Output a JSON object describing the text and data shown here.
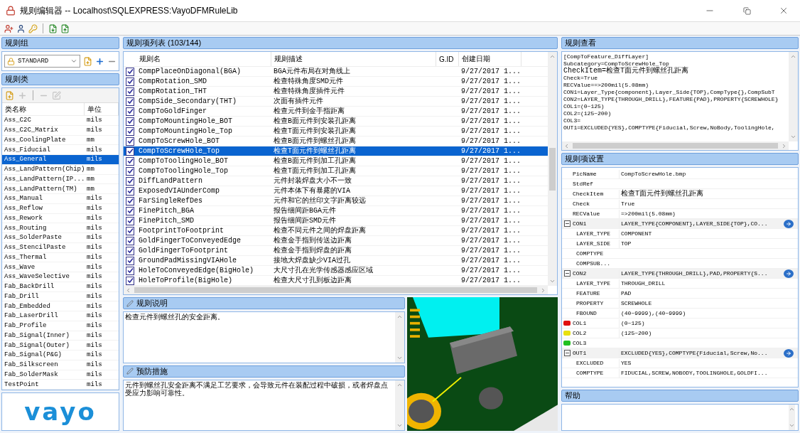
{
  "window": {
    "title": "规则编辑器 -- Localhost\\SQLEXPRESS:VayoDFMRuleLib"
  },
  "toolbar": [
    {
      "kind": "add_user"
    },
    {
      "kind": "user"
    },
    {
      "kind": "key"
    },
    {
      "kind": "separator"
    },
    {
      "kind": "import"
    },
    {
      "kind": "export"
    }
  ],
  "rule_group": {
    "title": "规则组",
    "value": "STANDARD",
    "tools": [
      {
        "kind": "new"
      },
      {
        "kind": "add"
      },
      {
        "kind": "remove"
      }
    ]
  },
  "rule_class": {
    "title": "规则类",
    "tools": [
      {
        "kind": "new",
        "disabled": false
      },
      {
        "kind": "add",
        "disabled": true
      },
      {
        "kind": "separator"
      },
      {
        "kind": "remove",
        "disabled": true
      },
      {
        "kind": "edit",
        "disabled": true
      }
    ],
    "columns": [
      "类名称",
      "单位"
    ],
    "rows": [
      {
        "name": "Ass_C2C",
        "unit": "mils",
        "selected": false
      },
      {
        "name": "Ass_C2C_Matrix",
        "unit": "mils",
        "selected": false
      },
      {
        "name": "Ass_CoolingPlate",
        "unit": "mm",
        "selected": false
      },
      {
        "name": "Ass_Fiducial",
        "unit": "mils",
        "selected": false
      },
      {
        "name": "Ass_General",
        "unit": "mils",
        "selected": true
      },
      {
        "name": "Ass_LandPattern(Chip)",
        "unit": "mm",
        "selected": false
      },
      {
        "name": "Ass_LandPattern(IP...",
        "unit": "mm",
        "selected": false
      },
      {
        "name": "Ass_LandPattern(TM)",
        "unit": "mm",
        "selected": false
      },
      {
        "name": "Ass_Manual",
        "unit": "mils",
        "selected": false
      },
      {
        "name": "Ass_Reflow",
        "unit": "mils",
        "selected": false
      },
      {
        "name": "Ass_Rework",
        "unit": "mils",
        "selected": false
      },
      {
        "name": "Ass_Routing",
        "unit": "mils",
        "selected": false
      },
      {
        "name": "Ass_SolderPaste",
        "unit": "mils",
        "selected": false
      },
      {
        "name": "Ass_StencilPaste",
        "unit": "mils",
        "selected": false
      },
      {
        "name": "Ass_Thermal",
        "unit": "mils",
        "selected": false
      },
      {
        "name": "Ass_Wave",
        "unit": "mils",
        "selected": false
      },
      {
        "name": "Ass_WaveSelective",
        "unit": "mils",
        "selected": false
      },
      {
        "name": "Fab_BackDrill",
        "unit": "mils",
        "selected": false
      },
      {
        "name": "Fab_Drill",
        "unit": "mils",
        "selected": false
      },
      {
        "name": "Fab_Embedded",
        "unit": "mils",
        "selected": false
      },
      {
        "name": "Fab_LaserDrill",
        "unit": "mils",
        "selected": false
      },
      {
        "name": "Fab_Profile",
        "unit": "mils",
        "selected": false
      },
      {
        "name": "Fab_Signal(Inner)",
        "unit": "mils",
        "selected": false
      },
      {
        "name": "Fab_Signal(Outer)",
        "unit": "mils",
        "selected": false
      },
      {
        "name": "Fab_Signal(P&G)",
        "unit": "mils",
        "selected": false
      },
      {
        "name": "Fab_Silkscreen",
        "unit": "mils",
        "selected": false
      },
      {
        "name": "Fab_SolderMask",
        "unit": "mils",
        "selected": false
      },
      {
        "name": "TestPoint",
        "unit": "mils",
        "selected": false
      }
    ]
  },
  "logo": "vayo",
  "rule_list": {
    "title": "规则项列表 (103/144)",
    "columns": [
      "规则名",
      "规则描述",
      "G.ID",
      "创建日期"
    ],
    "rows": [
      {
        "checked": true,
        "selected": false,
        "name": "CompPlaceOnDiagonal(BGA)",
        "desc": "BGA元件布局在对角线上",
        "date": "9/27/2017 1..."
      },
      {
        "checked": true,
        "selected": false,
        "name": "CompRotation_SMD",
        "desc": "检查特殊角度SMD元件",
        "date": "9/27/2017 1..."
      },
      {
        "checked": true,
        "selected": false,
        "name": "CompRotation_THT",
        "desc": "检查特殊角度插件元件",
        "date": "9/27/2017 1..."
      },
      {
        "checked": true,
        "selected": false,
        "name": "CompSide_Secondary(THT)",
        "desc": "次面有插件元件",
        "date": "9/27/2017 1..."
      },
      {
        "checked": true,
        "selected": false,
        "name": "CompToGoldFinger",
        "desc": "检查元件到金手指距离",
        "date": "9/27/2017 1..."
      },
      {
        "checked": true,
        "selected": false,
        "name": "CompToMountingHole_BOT",
        "desc": "检查B面元件到安装孔距离",
        "date": "9/27/2017 1..."
      },
      {
        "checked": true,
        "selected": false,
        "name": "CompToMountingHole_Top",
        "desc": "检查T面元件到安装孔距离",
        "date": "9/27/2017 1..."
      },
      {
        "checked": true,
        "selected": false,
        "name": "CompToScrewHole_BOT",
        "desc": "检查B面元件到螺丝孔距离",
        "date": "9/27/2017 1..."
      },
      {
        "checked": true,
        "selected": true,
        "name": "CompToScrewHole_Top",
        "desc": "检查T面元件到螺丝孔距离",
        "date": "9/27/2017 1..."
      },
      {
        "checked": true,
        "selected": false,
        "name": "CompToToolingHole_BOT",
        "desc": "检查B面元件到加工孔距离",
        "date": "9/27/2017 1..."
      },
      {
        "checked": true,
        "selected": false,
        "name": "CompToToolingHole_Top",
        "desc": "检查T面元件到加工孔距离",
        "date": "9/27/2017 1..."
      },
      {
        "checked": true,
        "selected": false,
        "name": "DiffLandPattern",
        "desc": "元件封装焊盘大小不一致",
        "date": "9/27/2017 1..."
      },
      {
        "checked": true,
        "selected": false,
        "name": "ExposedVIAUnderComp",
        "desc": "元件本体下有暴露的VIA",
        "date": "9/27/2017 1..."
      },
      {
        "checked": true,
        "selected": false,
        "name": "FarSingleRefDes",
        "desc": "元件和它的丝印文字距离较远",
        "date": "9/27/2017 1..."
      },
      {
        "checked": true,
        "selected": false,
        "name": "FinePitch_BGA",
        "desc": "报告细间距BGA元件",
        "date": "9/27/2017 1..."
      },
      {
        "checked": true,
        "selected": false,
        "name": "FinePitch_SMD",
        "desc": "报告细间距SMD元件",
        "date": "9/27/2017 1..."
      },
      {
        "checked": true,
        "selected": false,
        "name": "FootprintToFootprint",
        "desc": "检查不同元件之间的焊盘距离",
        "date": "9/27/2017 1..."
      },
      {
        "checked": true,
        "selected": false,
        "name": "GoldFingerToConveyedEdge",
        "desc": "检查金手指到传送边距离",
        "date": "9/27/2017 1..."
      },
      {
        "checked": true,
        "selected": false,
        "name": "GoldFingerToFootprint",
        "desc": "检查金手指到焊盘的距离",
        "date": "9/27/2017 1..."
      },
      {
        "checked": true,
        "selected": false,
        "name": "GroundPadMissingVIAHole",
        "desc": "接地大焊盘缺少VIA过孔",
        "date": "9/27/2017 1..."
      },
      {
        "checked": true,
        "selected": false,
        "name": "HoleToConveyedEdge(BigHole)",
        "desc": "大尺寸孔在光学传感器感应区域",
        "date": "9/27/2017 1..."
      },
      {
        "checked": true,
        "selected": false,
        "name": "HoleToProfile(BigHole)",
        "desc": "检查大尺寸孔到板边距离",
        "date": "9/27/2017 1..."
      }
    ]
  },
  "description": {
    "title": "规则说明",
    "text": "检查元件到螺丝孔的安全距离。"
  },
  "prevention": {
    "title": "预防措施",
    "text": "元件到螺丝孔安全距离不满足工艺要求，会导致元件在装配过程中破损，或者焊盘点受应力影响可靠性。"
  },
  "viewer": {
    "title": "规则查看",
    "lines": [
      "[CompToFeature_DiffLayer]",
      "Subcategory=CompToScrewHole_Top",
      "CheckItem=检查T面元件到螺丝孔距离",
      "Check=True",
      "RECValue==>200mil(5.08mm)",
      "CON1=Layer_Type{component},Layer_Side{TOP},CompType{},CompSubT",
      "CON2=LAYER_TYPE{THROUGH_DRILL},FEATURE{PAD},PROPERTY{SCREWHOLE}",
      "COL1=(0~125)",
      "COL2=(125~200)",
      "COL3=",
      "OUT1=EXCLUDED{YES},COMPTYPE{Fiducial,Screw,NoBody,ToolingHole,"
    ]
  },
  "settings": {
    "title": "规则项设置",
    "items": [
      {
        "kind": "prop",
        "name": "PicName",
        "value": "CompToScrewHole.bmp"
      },
      {
        "kind": "prop",
        "name": "StdRef"
      },
      {
        "kind": "prop",
        "name": "CheckItem",
        "value": "检查T面元件到螺丝孔距离"
      },
      {
        "kind": "prop",
        "name": "Check",
        "value": "True"
      },
      {
        "kind": "prop",
        "name": "RECValue",
        "value": "=>200mil(5.08mm)"
      },
      {
        "kind": "group",
        "name": "CON1",
        "value": "LAYER_TYPE{COMPONENT},LAYER_SIDE{TOP},CO...",
        "expanded": true,
        "children": [
          {
            "name": "LAYER_TYPE",
            "value": "COMPONENT"
          },
          {
            "name": "LAYER_SIDE",
            "value": "TOP"
          },
          {
            "name": "COMPTYPE"
          },
          {
            "name": "COMPSUB..."
          }
        ]
      },
      {
        "kind": "group",
        "name": "CON2",
        "value": "LAYER_TYPE{THROUGH_DRILL},PAD,PROPERTY{S...",
        "expanded": true,
        "children": [
          {
            "name": "LAYER_TYPE",
            "value": "THROUGH_DRILL"
          },
          {
            "name": "FEATURE",
            "value": "PAD"
          },
          {
            "name": "PROPERTY",
            "value": "SCREWHOLE"
          },
          {
            "name": "FBOUND",
            "value": "(40~9999),(40~9999)"
          }
        ]
      },
      {
        "kind": "color",
        "name": "COL1",
        "value": "(0~125)",
        "color": "#e01010"
      },
      {
        "kind": "color",
        "name": "COL2",
        "value": "(125~200)",
        "color": "#e8e010"
      },
      {
        "kind": "color",
        "name": "COL3",
        "color": "#20c020"
      },
      {
        "kind": "group",
        "name": "OUT1",
        "value": "EXCLUDED{YES},COMPTYPE{Fiducial,Screw,No...",
        "expanded": true,
        "children": [
          {
            "name": "EXCLUDED",
            "value": "YES"
          },
          {
            "name": "COMPTYPE",
            "value": "FIDUCIAL,SCREW,NOBODY,TOOLINGHOLE,GOLDFI..."
          }
        ]
      }
    ]
  },
  "help": {
    "title": "帮助"
  }
}
